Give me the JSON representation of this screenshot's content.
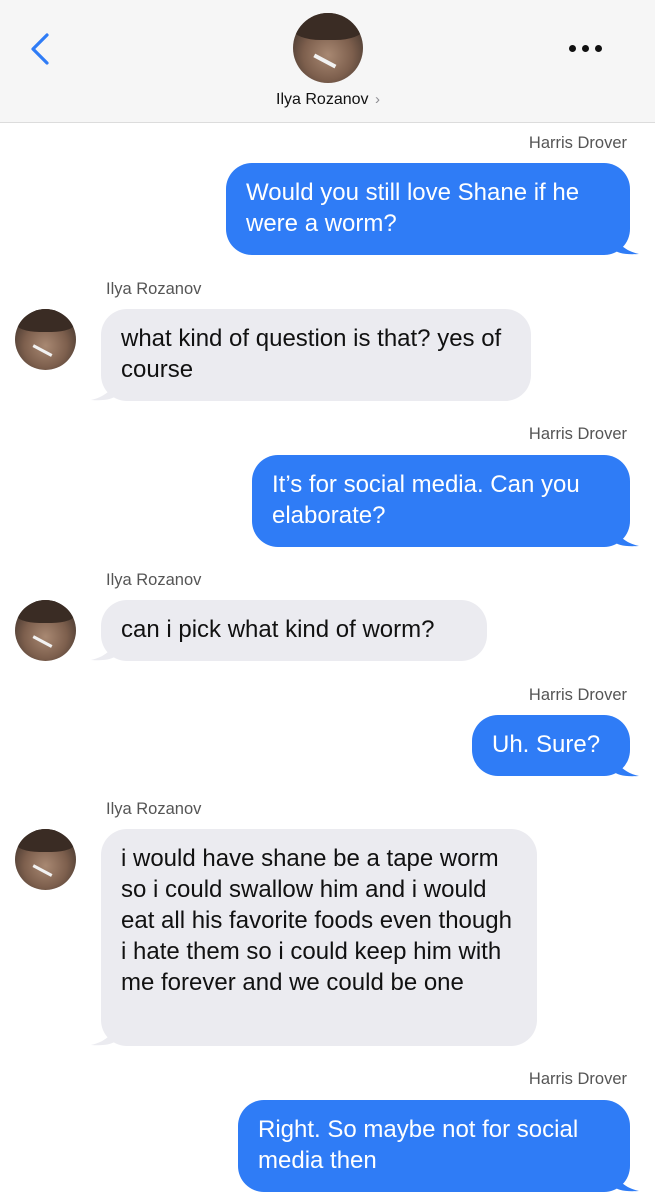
{
  "header": {
    "contact_name": "Ilya Rozanov",
    "chevron": "›",
    "back_icon": "chevron-left-icon",
    "more_icon": "ellipsis-icon",
    "accent": "#2f7cf6"
  },
  "messages": [
    {
      "sender": "Harris Drover",
      "direction": "out",
      "text": "Would you still love Shane if he were a worm?"
    },
    {
      "sender": "Ilya Rozanov",
      "direction": "in",
      "text": "what kind of question is that? yes of course"
    },
    {
      "sender": "Harris Drover",
      "direction": "out",
      "text": "It’s for social media. Can you elaborate?"
    },
    {
      "sender": "Ilya Rozanov",
      "direction": "in",
      "text": "can i pick what kind of worm?"
    },
    {
      "sender": "Harris Drover",
      "direction": "out",
      "text": "Uh. Sure?"
    },
    {
      "sender": "Ilya Rozanov",
      "direction": "in",
      "text": "i would have shane be a tape worm so i could swallow him and i would eat all his favorite foods even though i hate them so i could keep him with me forever and we could be one"
    },
    {
      "sender": "Harris Drover",
      "direction": "out",
      "text": "Right. So maybe not for social media then"
    }
  ],
  "colors": {
    "outgoing_bubble": "#2f7cf6",
    "incoming_bubble": "#ebebf0"
  }
}
